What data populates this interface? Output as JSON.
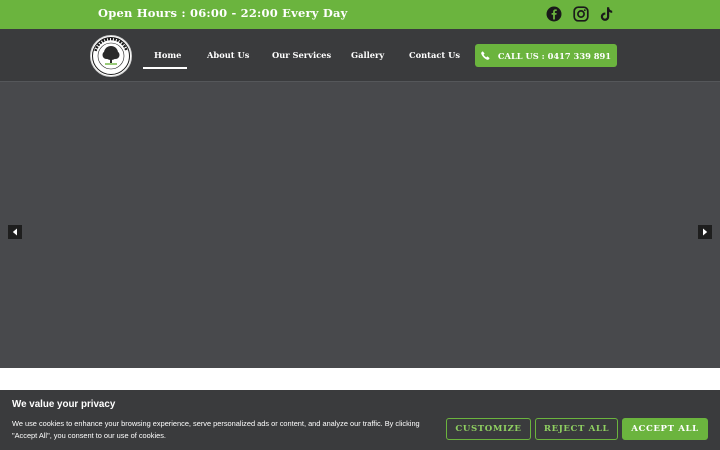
{
  "topbar": {
    "hours": "Open Hours : 06:00 - 22:00 Every Day",
    "social": [
      "facebook-icon",
      "instagram-icon",
      "tiktok-icon"
    ]
  },
  "nav": {
    "items": [
      {
        "label": "Home",
        "active": true
      },
      {
        "label": "About Us"
      },
      {
        "label": "Our Services"
      },
      {
        "label": "Gallery"
      },
      {
        "label": "Contact Us"
      }
    ],
    "call_label": "CALL US : 0417 339 891"
  },
  "cookie": {
    "title": "We value your privacy",
    "text": "We use cookies to enhance your browsing experience, serve personalized ads or content, and analyze our traffic. By clicking \"Accept All\", you consent to our use of cookies.",
    "customize": "CUSTOMIZE",
    "reject": "REJECT ALL",
    "accept": "ACCEPT ALL"
  },
  "colors": {
    "brand_green": "#6bb43e",
    "nav_bg": "#3a3b3d",
    "hero_bg": "#48494c"
  }
}
